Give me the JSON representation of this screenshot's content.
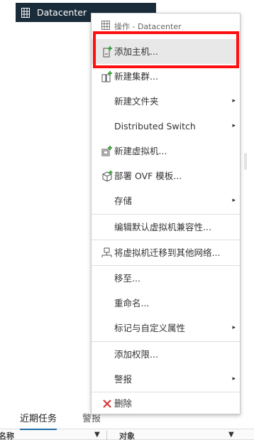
{
  "tree": {
    "datacenter_label": "Datacenter"
  },
  "context_menu": {
    "header": "操作 - Datacenter",
    "items": [
      {
        "label": "添加主机...",
        "icon": "add-host-icon",
        "submenu": false
      },
      {
        "label": "新建集群...",
        "icon": "new-cluster-icon",
        "submenu": false
      },
      {
        "label": "新建文件夹",
        "icon": "",
        "submenu": true
      },
      {
        "label": "Distributed Switch",
        "icon": "",
        "submenu": true
      },
      {
        "label": "新建虚拟机...",
        "icon": "new-vm-icon",
        "submenu": false
      },
      {
        "label": "部署 OVF 模板...",
        "icon": "deploy-ovf-icon",
        "submenu": false
      },
      {
        "label": "存储",
        "icon": "",
        "submenu": true
      },
      {
        "label": "编辑默认虚拟机兼容性...",
        "icon": "",
        "submenu": false
      },
      {
        "label": "将虚拟机迁移到其他网络...",
        "icon": "migrate-network-icon",
        "submenu": false
      },
      {
        "label": "移至...",
        "icon": "",
        "submenu": false
      },
      {
        "label": "重命名...",
        "icon": "",
        "submenu": false
      },
      {
        "label": "标记与自定义属性",
        "icon": "",
        "submenu": true
      },
      {
        "label": "添加权限...",
        "icon": "",
        "submenu": false
      },
      {
        "label": "警报",
        "icon": "",
        "submenu": true
      },
      {
        "label": "删除",
        "icon": "delete-icon",
        "submenu": false
      }
    ],
    "submenu_arrow": "▸"
  },
  "bottom_panel": {
    "tabs": [
      "近期任务",
      "警报"
    ],
    "columns": [
      "名称",
      "对象"
    ],
    "sort_caret": "▼"
  },
  "colors": {
    "tree_row_bg": "#1a2c3a",
    "highlight_box": "#ff1010",
    "active_tab_underline": "#1d6ca8",
    "icon_green": "#3aa33a",
    "delete_red": "#d9383a"
  }
}
